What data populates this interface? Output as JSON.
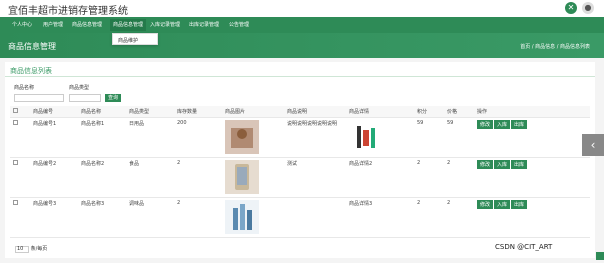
{
  "app": {
    "title": "宜佰丰超市进销存管理系统"
  },
  "nav": {
    "items": [
      "个人中心",
      "用户管理",
      "商品信息管理",
      "商品信息管理",
      "入库记录管理",
      "出库记录管理",
      "公告管理"
    ],
    "active_index": 3,
    "dropdown_item": "商品维护"
  },
  "header": {
    "page_title": "商品信息管理",
    "breadcrumb": "首页 / 商品信息 / 商品信息列表"
  },
  "panel": {
    "title": "商品信息列表",
    "filters": {
      "name_label": "商品名称",
      "name_value": "",
      "type_label": "商品类型",
      "type_value": "",
      "search_button": "查询"
    }
  },
  "table": {
    "columns": [
      "",
      "商品编号",
      "商品名称",
      "商品类型",
      "库存数量",
      "商品图片",
      "商品说明",
      "商品详情",
      "积分",
      "价格",
      "操作"
    ],
    "rows": [
      {
        "cells": [
          "",
          "商品编号1",
          "商品名称1",
          "日用品",
          "200",
          "",
          "说明说明说明说明说明",
          "",
          "59",
          "59",
          ""
        ]
      },
      {
        "cells": [
          "",
          "商品编号2",
          "商品名称2",
          "食品",
          "2",
          "",
          "测试",
          "商品详情2",
          "2",
          "2",
          ""
        ]
      },
      {
        "cells": [
          "",
          "商品编号3",
          "商品名称3",
          "调味品",
          "2",
          "",
          "",
          "商品详情3",
          "2",
          "2",
          ""
        ]
      }
    ],
    "actions": [
      "修改",
      "入库",
      "出库"
    ]
  },
  "pagination": {
    "page_size": "10",
    "suffix": "条/每页"
  },
  "watermark": "CSDN @CIT_ART",
  "colors": {
    "primary": "#2e8b57",
    "primary_dark": "#247a4a",
    "background": "#f4f4f4"
  }
}
